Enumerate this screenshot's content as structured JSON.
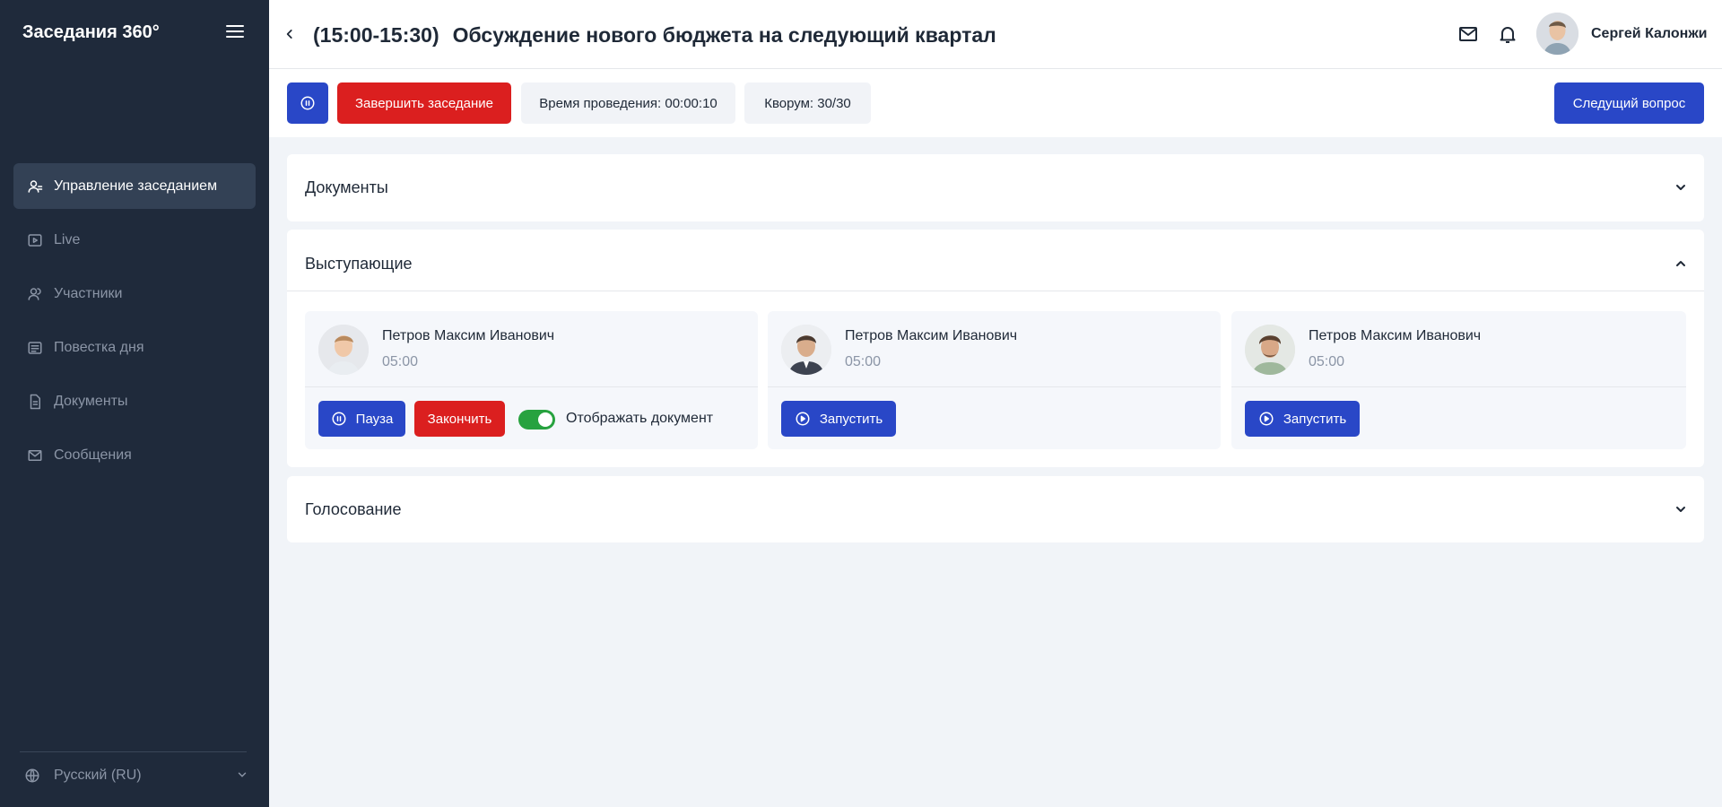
{
  "app": {
    "brand": "Заседания 360°"
  },
  "sidebar": {
    "items": [
      {
        "label": "Управление заседанием",
        "icon": "user-manage-icon",
        "active": true
      },
      {
        "label": "Live",
        "icon": "play-screen-icon"
      },
      {
        "label": "Участники",
        "icon": "users-icon"
      },
      {
        "label": "Повестка дня",
        "icon": "agenda-icon"
      },
      {
        "label": "Документы",
        "icon": "document-icon"
      },
      {
        "label": "Сообщения",
        "icon": "mail-icon"
      }
    ],
    "language": "Русский (RU)"
  },
  "header": {
    "time_range": "(15:00-15:30)",
    "title": "Обсуждение нового бюджета на следующий квартал",
    "user_name": "Сергей Калонжи"
  },
  "toolbar": {
    "end_meeting": "Завершить заседание",
    "duration": "Время проведения: 00:00:10",
    "quorum": "Кворум: 30/30",
    "next_question": "Следущий вопрос"
  },
  "sections": {
    "documents": "Документы",
    "speakers": "Выступающие",
    "voting": "Голосование"
  },
  "speakers": [
    {
      "name": "Петров Максим Иванович",
      "time": "05:00",
      "pause": "Пауза",
      "finish": "Закончить",
      "show_document": "Отображать документ",
      "show_document_on": true
    },
    {
      "name": "Петров Максим Иванович",
      "time": "05:00",
      "start": "Запустить"
    },
    {
      "name": "Петров Максим Иванович",
      "time": "05:00",
      "start": "Запустить"
    }
  ],
  "colors": {
    "sidebar_bg": "#1f2a3b",
    "primary": "#2947c7",
    "danger": "#db1f1f",
    "success": "#27a23f",
    "page_bg": "#f1f4f8"
  }
}
